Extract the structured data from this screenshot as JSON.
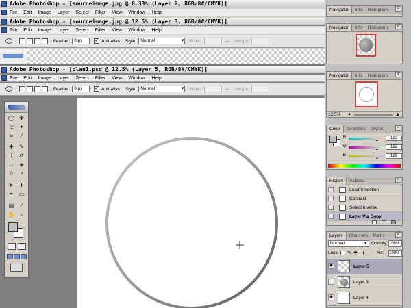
{
  "app_name": "Adobe Photoshop",
  "windows": [
    {
      "title": "Adobe Photoshop - [sourceimage.jpg @ 8.33% (Layer 2, RGB/8#/CMYK)]"
    },
    {
      "title": "Adobe Photoshop - [sourceimage.jpg @ 12.5% (Layer 3, RGB/8#/CMYK)]"
    },
    {
      "title": "Adobe Photoshop - [plan1.psd @ 12.5% (Layer 5, RGB/8#/CMYK)]"
    }
  ],
  "menu": [
    "File",
    "Edit",
    "Image",
    "Layer",
    "Select",
    "Filter",
    "View",
    "Window",
    "Help"
  ],
  "options_bar": {
    "feather_label": "Feather:",
    "feather_value": "0 px",
    "antialias_label": "Anti-alias",
    "style_label": "Style:",
    "style_value": "Normal",
    "width_label": "Width:",
    "height_label": "Height:"
  },
  "navigator": {
    "tabs": [
      "Navigator",
      "Info",
      "Histogram"
    ],
    "zoom": "12.5%"
  },
  "color": {
    "tabs": [
      "Color",
      "Swatches",
      "Styles"
    ],
    "channels": [
      {
        "label": "R",
        "value": "192"
      },
      {
        "label": "G",
        "value": "192"
      },
      {
        "label": "B",
        "value": "192"
      }
    ],
    "foreground": "#c0c0c0",
    "background": "#ffffff"
  },
  "history": {
    "tabs": [
      "History",
      "Actions"
    ],
    "items": [
      "Load Selection",
      "Contract",
      "Select Inverse",
      "Layer Via Copy"
    ]
  },
  "layers": {
    "tabs": [
      "Layers",
      "Channels",
      "Paths"
    ],
    "blend_mode": "Normal",
    "opacity_label": "Opacity:",
    "opacity_value": "100%",
    "lock_label": "Lock:",
    "fill_label": "Fill:",
    "fill_value": "100%",
    "items": [
      "Layer 5",
      "Layer 3",
      "Layer 4"
    ]
  },
  "icons": {
    "marquee": "elliptical-marquee-icon",
    "move": "move-icon",
    "crosshair": "crosshair-cursor-icon",
    "eye": "eye-icon"
  }
}
